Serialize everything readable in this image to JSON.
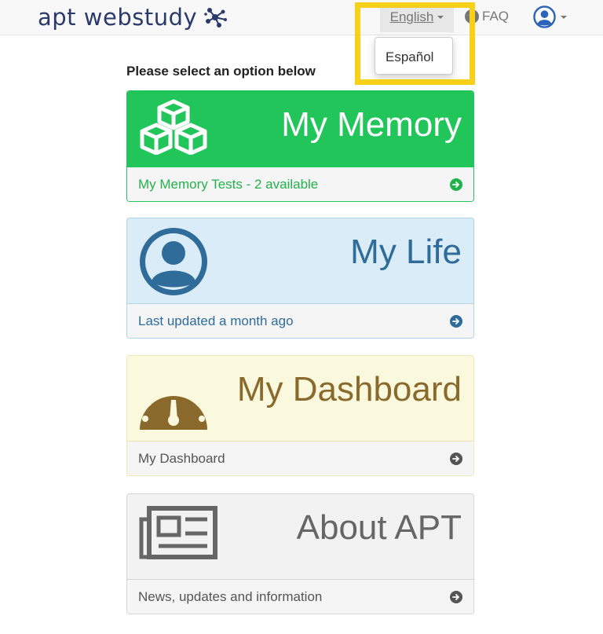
{
  "header": {
    "brand": "apt webstudy",
    "brand_icon": "network-nodes-icon",
    "language_label": "English",
    "language_options": [
      "Español"
    ],
    "faq_label": "FAQ",
    "user_icon": "user-circle-icon"
  },
  "main": {
    "prompt": "Please select an option below",
    "cards": [
      {
        "title": "My Memory",
        "footer": "My Memory Tests - 2 available",
        "icon": "cubes-icon",
        "accent": "#22c55a"
      },
      {
        "title": "My Life",
        "footer": "Last updated a month ago",
        "icon": "user-circle-icon",
        "accent": "#2f6c9a"
      },
      {
        "title": "My Dashboard",
        "footer": "My Dashboard",
        "icon": "dashboard-gauge-icon",
        "accent": "#8a6a2c"
      },
      {
        "title": "About APT",
        "footer": "News, updates and information",
        "icon": "newspaper-icon",
        "accent": "#666666"
      }
    ]
  },
  "colors": {
    "highlight": "#f7d117",
    "brand": "#2a3a6b"
  }
}
